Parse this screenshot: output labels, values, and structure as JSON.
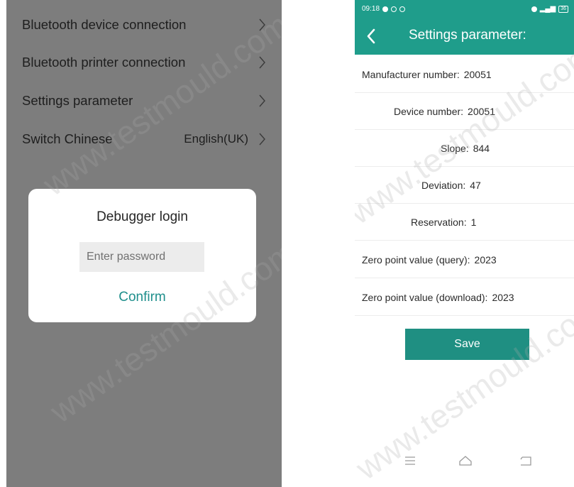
{
  "left": {
    "menu": [
      {
        "label": "Bluetooth device connection",
        "value": ""
      },
      {
        "label": "Bluetooth printer connection",
        "value": ""
      },
      {
        "label": "Settings parameter",
        "value": ""
      },
      {
        "label": "Switch Chinese",
        "value": "English(UK)"
      }
    ],
    "dialog": {
      "title": "Debugger login",
      "password_placeholder": "Enter password",
      "password_value": "",
      "confirm_label": "Confirm"
    }
  },
  "right": {
    "status_bar": {
      "time": "09:18",
      "battery": "36"
    },
    "app_bar": {
      "title": "Settings parameter:"
    },
    "params": [
      {
        "label": "Manufacturer number:",
        "value": "20051"
      },
      {
        "label": "Device number:",
        "value": "20051"
      },
      {
        "label": "Slope:",
        "value": "844"
      },
      {
        "label": "Deviation:",
        "value": "47"
      },
      {
        "label": "Reservation:",
        "value": "1"
      },
      {
        "label": "Zero point value (query):",
        "value": "2023"
      },
      {
        "label": "Zero point value (download):",
        "value": "2023"
      }
    ],
    "save_label": "Save",
    "nav_icons": [
      "menu-icon",
      "home-icon",
      "back-icon"
    ]
  },
  "watermark": "www.testmould.com",
  "colors": {
    "accent": "#1f9d8b",
    "overlay": "#7d7d7d",
    "confirm": "#1f8f8c"
  }
}
